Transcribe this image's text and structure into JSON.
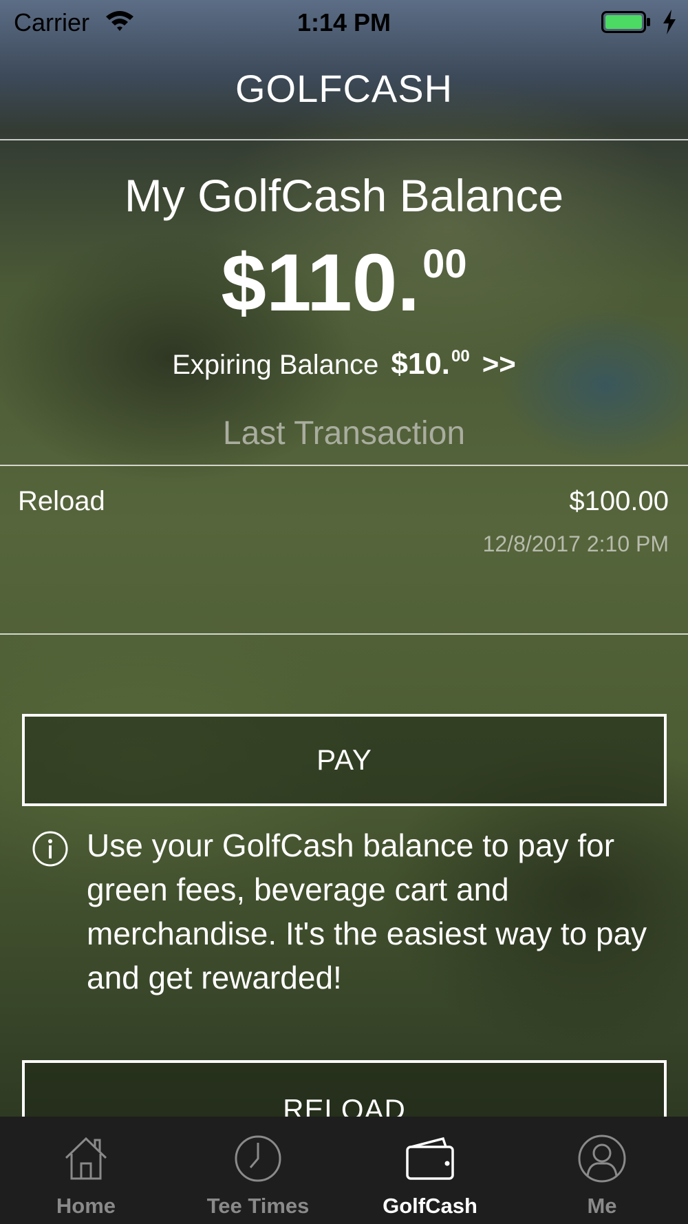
{
  "status_bar": {
    "carrier": "Carrier",
    "time": "1:14 PM",
    "battery_color": "#4cd964"
  },
  "nav": {
    "title": "GOLFCASH"
  },
  "balance": {
    "title": "My GolfCash Balance",
    "dollars": "$110.",
    "cents": "00",
    "expiring_label": "Expiring Balance",
    "expiring_dollars": "$10.",
    "expiring_cents": "00",
    "expiring_chevron": ">>"
  },
  "last_transaction": {
    "label": "Last Transaction",
    "type": "Reload",
    "amount": "$100.00",
    "date": "12/8/2017 2:10 PM"
  },
  "actions": {
    "pay_label": "PAY",
    "info_icon": "info-icon",
    "info_text": "Use your GolfCash balance to pay for green fees, beverage cart and merchandise. It's the easiest way to pay and get rewarded!",
    "reload_label": "RELOAD"
  },
  "tab_bar": {
    "tabs": [
      {
        "label": "Home",
        "icon": "home-icon",
        "active": false
      },
      {
        "label": "Tee Times",
        "icon": "clock-icon",
        "active": false
      },
      {
        "label": "GolfCash",
        "icon": "wallet-icon",
        "active": true
      },
      {
        "label": "Me",
        "icon": "user-icon",
        "active": false
      }
    ]
  }
}
